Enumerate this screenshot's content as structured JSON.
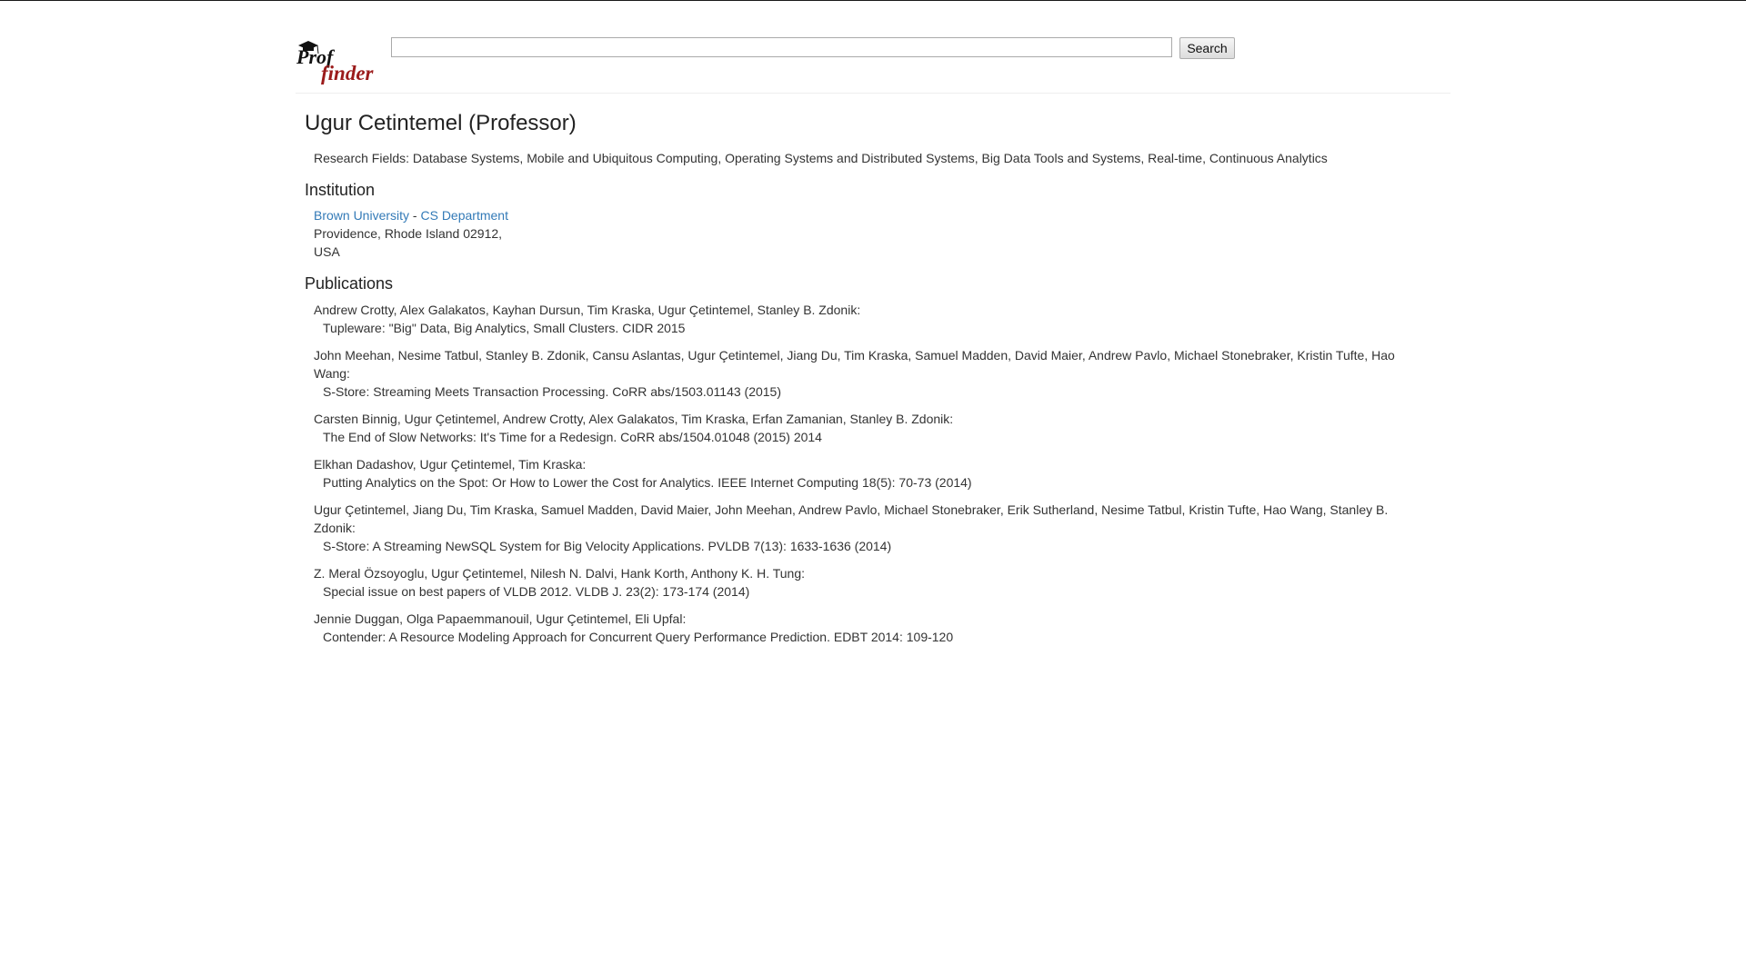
{
  "search": {
    "value": "",
    "placeholder": "",
    "button_label": "Search"
  },
  "logo": {
    "line1": "Prof",
    "line2": "finder",
    "icon": "graduation-cap-icon"
  },
  "professor": {
    "title": "Ugur Cetintemel (Professor)",
    "research_fields": "Research Fields: Database Systems, Mobile and Ubiquitous Computing, Operating Systems and Distributed Systems, Big Data Tools and Systems, Real-time, Continuous Analytics"
  },
  "institution": {
    "heading": "Institution",
    "university": "Brown University",
    "separator": " - ",
    "department": "CS Department",
    "address_line1": "Providence, Rhode Island 02912,",
    "address_line2": "USA"
  },
  "publications": {
    "heading": "Publications",
    "items": [
      {
        "authors": "Andrew Crotty, Alex Galakatos, Kayhan Dursun, Tim Kraska, Ugur Çetintemel, Stanley B. Zdonik:",
        "title": "Tupleware: \"Big\" Data, Big Analytics, Small Clusters. CIDR 2015"
      },
      {
        "authors": "John Meehan, Nesime Tatbul, Stanley B. Zdonik, Cansu Aslantas, Ugur Çetintemel, Jiang Du, Tim Kraska, Samuel Madden, David Maier, Andrew Pavlo, Michael Stonebraker, Kristin Tufte, Hao Wang:",
        "title": "S-Store: Streaming Meets Transaction Processing. CoRR abs/1503.01143 (2015)"
      },
      {
        "authors": "Carsten Binnig, Ugur Çetintemel, Andrew Crotty, Alex Galakatos, Tim Kraska, Erfan Zamanian, Stanley B. Zdonik:",
        "title": "The End of Slow Networks: It's Time for a Redesign. CoRR abs/1504.01048 (2015) 2014"
      },
      {
        "authors": "Elkhan Dadashov, Ugur Çetintemel, Tim Kraska:",
        "title": "Putting Analytics on the Spot: Or How to Lower the Cost for Analytics. IEEE Internet Computing 18(5): 70-73 (2014)"
      },
      {
        "authors": "Ugur Çetintemel, Jiang Du, Tim Kraska, Samuel Madden, David Maier, John Meehan, Andrew Pavlo, Michael Stonebraker, Erik Sutherland, Nesime Tatbul, Kristin Tufte, Hao Wang, Stanley B. Zdonik:",
        "title": "S-Store: A Streaming NewSQL System for Big Velocity Applications. PVLDB 7(13): 1633-1636 (2014)"
      },
      {
        "authors": "Z. Meral Özsoyoglu, Ugur Çetintemel, Nilesh N. Dalvi, Hank Korth, Anthony K. H. Tung:",
        "title": "Special issue on best papers of VLDB 2012. VLDB J. 23(2): 173-174 (2014)"
      },
      {
        "authors": "Jennie Duggan, Olga Papaemmanouil, Ugur Çetintemel, Eli Upfal:",
        "title": "Contender: A Resource Modeling Approach for Concurrent Query Performance Prediction. EDBT 2014: 109-120"
      }
    ]
  }
}
